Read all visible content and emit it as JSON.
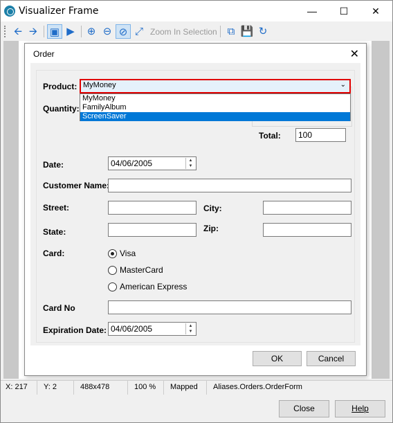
{
  "window": {
    "title": "Visualizer Frame"
  },
  "toolbar": {
    "zoom_label": "Zoom In Selection"
  },
  "dialog": {
    "title": "Order",
    "product": {
      "label": "Product:",
      "value": "MyMoney",
      "options": [
        "MyMoney",
        "FamilyAlbum",
        "ScreenSaver"
      ]
    },
    "quantity": {
      "label": "Quantity:"
    },
    "total": {
      "label": "Total:",
      "value": "100"
    },
    "date": {
      "label": "Date:",
      "value": "04/06/2005"
    },
    "customer_name": {
      "label": "Customer Name:",
      "value": ""
    },
    "street": {
      "label": "Street:",
      "value": ""
    },
    "city": {
      "label": "City:",
      "value": ""
    },
    "state": {
      "label": "State:",
      "value": ""
    },
    "zip": {
      "label": "Zip:",
      "value": ""
    },
    "card": {
      "label": "Card:",
      "options": [
        "Visa",
        "MasterCard",
        "American Express"
      ],
      "selected": "Visa"
    },
    "card_no": {
      "label": "Card No",
      "value": ""
    },
    "expiration": {
      "label": "Expiration Date:",
      "value": "04/06/2005"
    },
    "ok_label": "OK",
    "cancel_label": "Cancel"
  },
  "status": {
    "x": "X: 217",
    "y": "Y: 2",
    "size": "488x478",
    "zoom": "100 %",
    "mapped": "Mapped",
    "alias": "Aliases.Orders.OrderForm"
  },
  "footer": {
    "close_label": "Close",
    "help_label": "Help"
  }
}
